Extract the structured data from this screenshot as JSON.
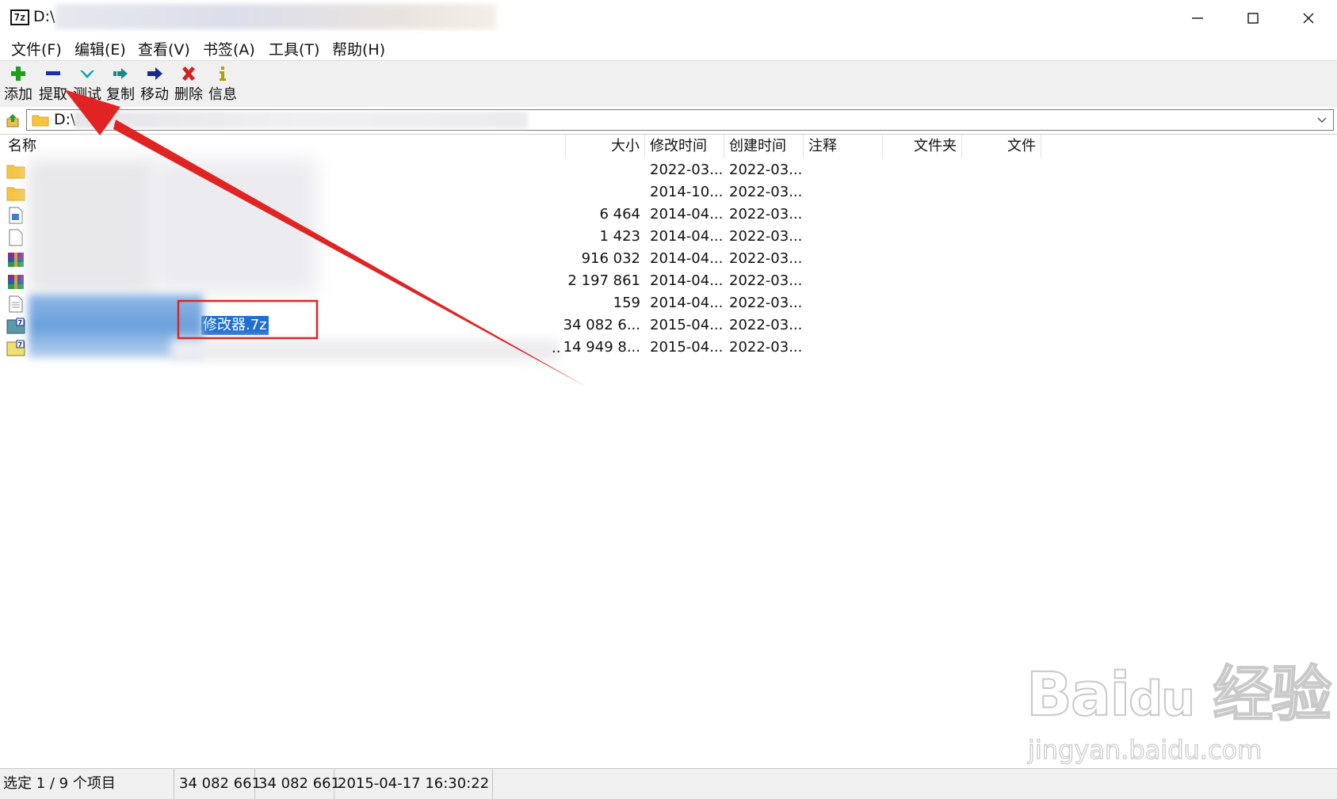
{
  "window": {
    "title": "D:\\",
    "app_icon_label": "7z",
    "controls": [
      "minimize",
      "maximize",
      "close"
    ]
  },
  "menu": [
    "文件(F)",
    "编辑(E)",
    "查看(V)",
    "书签(A)",
    "工具(T)",
    "帮助(H)"
  ],
  "toolbar": [
    {
      "label": "添加",
      "icon": "plus-icon",
      "color": "#1aa01a"
    },
    {
      "label": "提取",
      "icon": "minus-icon",
      "color": "#1a2ea8"
    },
    {
      "label": "测试",
      "icon": "check-icon",
      "color": "#11a3b0"
    },
    {
      "label": "复制",
      "icon": "copy-arrow-icon",
      "color": "#1a8a8a"
    },
    {
      "label": "移动",
      "icon": "move-arrow-icon",
      "color": "#1a2a8a"
    },
    {
      "label": "删除",
      "icon": "delete-x-icon",
      "color": "#d42020"
    },
    {
      "label": "信息",
      "icon": "info-icon",
      "color": "#b0a000"
    }
  ],
  "address": {
    "path": "D:\\"
  },
  "columns": [
    "名称",
    "大小",
    "修改时间",
    "创建时间",
    "注释",
    "文件夹",
    "文件"
  ],
  "files": [
    {
      "icon": "folder-icon",
      "name": "",
      "size": "",
      "modified": "2022-03...",
      "created": "2022-03..."
    },
    {
      "icon": "folder-icon",
      "name": "",
      "size": "",
      "modified": "2014-10...",
      "created": "2022-03..."
    },
    {
      "icon": "image-file-icon",
      "name": "",
      "size": "6 464",
      "modified": "2014-04...",
      "created": "2022-03..."
    },
    {
      "icon": "blank-file-icon",
      "name": "",
      "size": "1 423",
      "modified": "2014-04...",
      "created": "2022-03..."
    },
    {
      "icon": "rar-archive-icon",
      "name": "",
      "size": "916 032",
      "modified": "2014-04...",
      "created": "2022-03..."
    },
    {
      "icon": "rar-archive-icon",
      "name": "",
      "size": "2 197 861",
      "modified": "2014-04...",
      "created": "2022-03..."
    },
    {
      "icon": "text-file-icon",
      "name": "",
      "size": "159",
      "modified": "2014-04...",
      "created": "2022-03..."
    },
    {
      "icon": "7z-archive-icon",
      "name": "修改器.7z",
      "size": "34 082 6...",
      "modified": "2015-04...",
      "created": "2022-03...",
      "selected": true
    },
    {
      "icon": "7z-archive-icon",
      "name": "",
      "size": "14 949 8...",
      "modified": "2015-04...",
      "created": "2022-03..."
    }
  ],
  "truncation_marker": "..",
  "status": {
    "selection": "选定 1 / 9 个项目",
    "size": "34 082 661",
    "packed_size": "34 082 661",
    "modified": "2015-04-17 16:30:22"
  },
  "watermark": {
    "logo": "Bai du 经验",
    "url": "jingyan.baidu.com"
  },
  "annotation_color": "#e02424"
}
